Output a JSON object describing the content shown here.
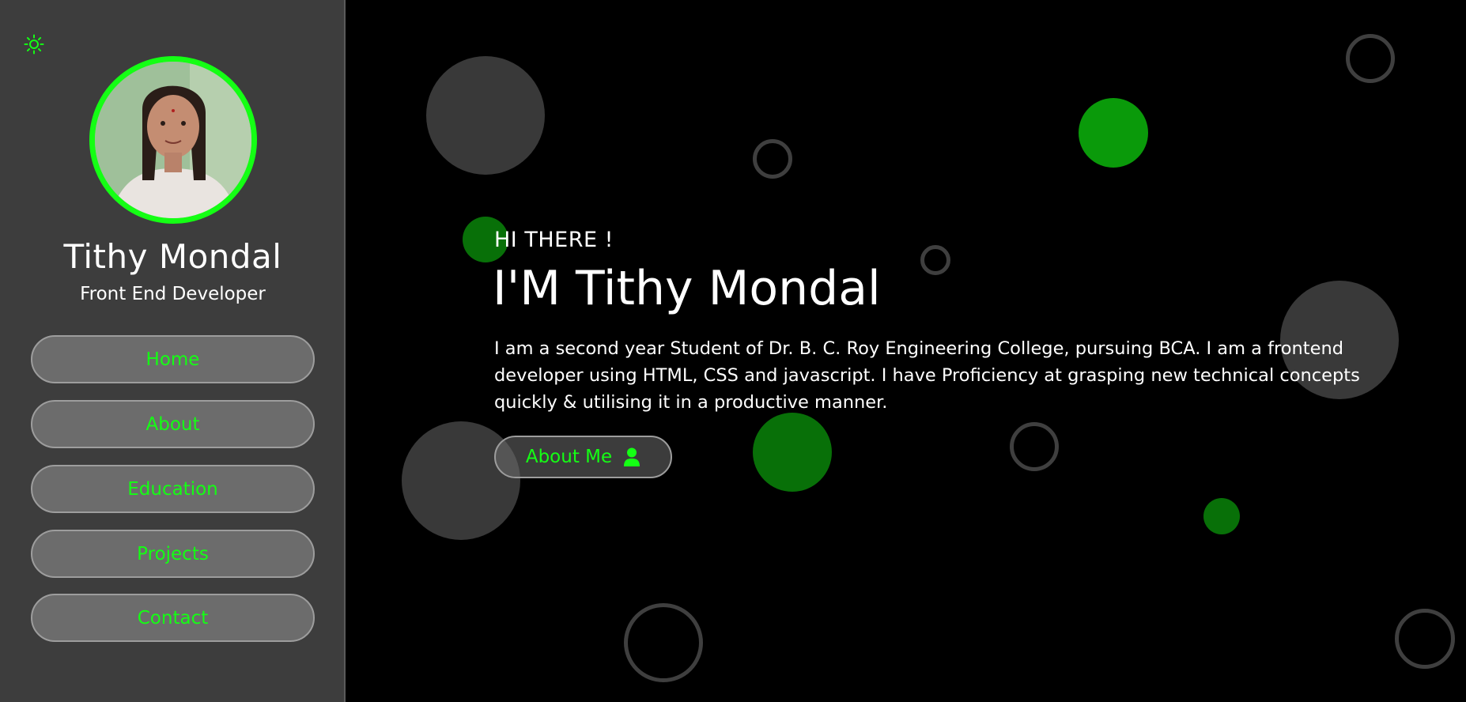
{
  "sidebar": {
    "theme_toggle_icon": "sun-icon",
    "avatar_icon": "profile-photo",
    "name": "Tithy Mondal",
    "role": "Front End Developer",
    "nav": [
      {
        "label": "Home"
      },
      {
        "label": "About"
      },
      {
        "label": "Education"
      },
      {
        "label": "Projects"
      },
      {
        "label": "Contact"
      }
    ]
  },
  "hero": {
    "greeting": "HI THERE !",
    "headline": "I'M Tithy Mondal",
    "bio": "I am a second year Student of Dr. B. C. Roy Engineering College, pursuing BCA. I am a frontend developer using HTML, CSS and javascript. I have Proficiency at grasping new technical concepts quickly & utilising it in a productive manner.",
    "about_button": {
      "label": "About Me",
      "icon": "user-icon"
    }
  },
  "colors": {
    "accent": "#14ff14",
    "sidebar_bg": "#3d3d3d",
    "main_bg": "#000000",
    "button_bg": "#6c6c6c"
  }
}
